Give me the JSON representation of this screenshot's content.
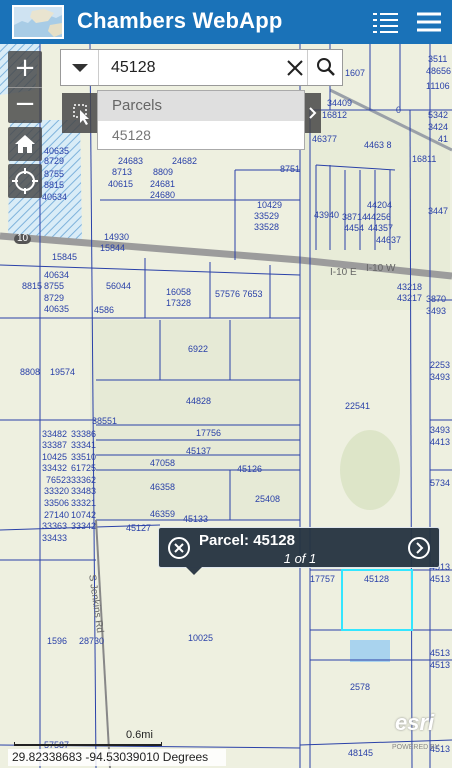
{
  "header": {
    "title": "Chambers WebApp",
    "list_icon": "layer-list-icon",
    "menu_icon": "hamburger-menu-icon"
  },
  "search": {
    "value": "45128",
    "dropdown_icon": "caret-down-icon",
    "clear_icon": "close-icon",
    "search_icon": "search-icon"
  },
  "suggestions": {
    "group": "Parcels",
    "items": [
      "45128"
    ]
  },
  "map_controls": {
    "zoom_in": "+",
    "zoom_out": "−"
  },
  "popup": {
    "title": "Parcel: 45128",
    "paging": "1 of 1"
  },
  "scale": {
    "label": "0.6mi"
  },
  "coords": {
    "text": "29.82338683 -94.53039010 Degrees"
  },
  "attribution": {
    "logo": "esri",
    "powered": "POWERED BY"
  },
  "road_labels": [
    "10",
    "I-10 E",
    "I-10 W",
    "S Jenkins Rd"
  ],
  "parcel_labels": [
    "1607",
    "3511",
    "48656",
    "11106",
    "34409",
    "16812",
    "0",
    "5342",
    "3424",
    "41",
    "46377",
    "4463 8",
    "16811",
    "40635",
    "8729",
    "8755",
    "8815",
    "40634",
    "24683",
    "24682",
    "8713",
    "8809",
    "40615",
    "24681",
    "24680",
    "8751",
    "10429",
    "33529",
    "33528",
    "43940",
    "38714",
    "4454",
    "44204",
    "44256",
    "44357",
    "44637",
    "3447",
    "14930",
    "15844",
    "15845",
    "40634",
    "8815",
    "8755",
    "8729",
    "40635",
    "56044",
    "16058",
    "17328",
    "57576 7653",
    "4586",
    "43218",
    "43217",
    "3870",
    "3493",
    "6922",
    "8808",
    "19574",
    "2253",
    "3493",
    "44828",
    "22541",
    "38551",
    "33482",
    "33386",
    "33387",
    "33341",
    "10425",
    "33510",
    "33432",
    "61725",
    "17756",
    "45137",
    "47058",
    "45126",
    "3493",
    "4413",
    "76523",
    "33362",
    "33320",
    "33483",
    "33506",
    "33321",
    "27140",
    "10742",
    "33363",
    "33342",
    "33433",
    "46358",
    "25408",
    "5734",
    "46359",
    "45133",
    "45127",
    "22541",
    "17757",
    "45128",
    "4513",
    "4513",
    "1596",
    "28730",
    "10025",
    "4513",
    "4513",
    "2578",
    "57587",
    "48145",
    "4513"
  ]
}
